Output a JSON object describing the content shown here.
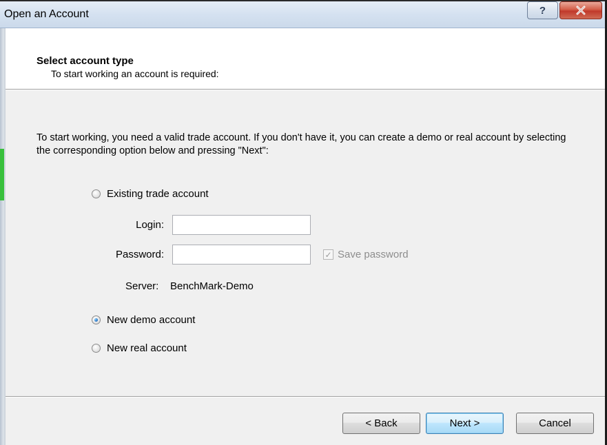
{
  "window": {
    "title": "Open an Account",
    "help_glyph": "?",
    "close_glyph": "✕"
  },
  "header": {
    "title": "Select account type",
    "subtitle": "To start working an account is required:"
  },
  "intro": {
    "text": "To start working, you need a valid trade account. If you don't have it, you can create a demo or real account by selecting the corresponding option below and pressing \"Next\":"
  },
  "options": {
    "existing": {
      "label": "Existing trade account",
      "checked": false
    },
    "demo": {
      "label": "New demo account",
      "checked": true
    },
    "real": {
      "label": "New real account",
      "checked": false
    }
  },
  "existing_form": {
    "login_label": "Login:",
    "login_value": "",
    "password_label": "Password:",
    "password_value": "",
    "save_password_label": "Save password",
    "save_password_checked": true,
    "server_label": "Server:",
    "server_value": "BenchMark-Demo"
  },
  "buttons": {
    "back": "< Back",
    "next": "Next >",
    "cancel": "Cancel"
  },
  "colors": {
    "accent": "#3c7fb1",
    "close": "#c0392b",
    "panel": "#f0f0f0"
  }
}
